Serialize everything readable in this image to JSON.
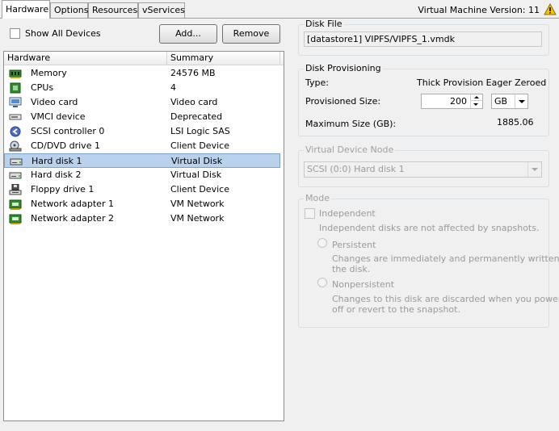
{
  "tabs": [
    {
      "label": "Hardware",
      "active": true
    },
    {
      "label": "Options",
      "active": false
    },
    {
      "label": "Resources",
      "active": false
    },
    {
      "label": "vServices",
      "active": false
    }
  ],
  "vm_version": "Virtual Machine Version: 11",
  "show_all_devices_label": "Show All Devices",
  "add_button": "Add...",
  "remove_button": "Remove",
  "columns": {
    "hardware": "Hardware",
    "summary": "Summary"
  },
  "devices": [
    {
      "name": "Memory",
      "summary": "24576 MB",
      "icon": "memory-icon"
    },
    {
      "name": "CPUs",
      "summary": "4",
      "icon": "cpu-icon"
    },
    {
      "name": "Video card",
      "summary": "Video card",
      "icon": "video-card-icon"
    },
    {
      "name": "VMCI device",
      "summary": "Deprecated",
      "icon": "vmci-device-icon"
    },
    {
      "name": "SCSI controller 0",
      "summary": "LSI Logic SAS",
      "icon": "scsi-controller-icon"
    },
    {
      "name": "CD/DVD drive 1",
      "summary": "Client Device",
      "icon": "cd-dvd-drive-icon"
    },
    {
      "name": "Hard disk 1",
      "summary": "Virtual Disk",
      "icon": "hard-disk-icon",
      "selected": true
    },
    {
      "name": "Hard disk 2",
      "summary": "Virtual Disk",
      "icon": "hard-disk-icon"
    },
    {
      "name": "Floppy drive 1",
      "summary": "Client Device",
      "icon": "floppy-drive-icon"
    },
    {
      "name": "Network adapter 1",
      "summary": "VM Network",
      "icon": "network-adapter-icon"
    },
    {
      "name": "Network adapter 2",
      "summary": "VM Network",
      "icon": "network-adapter-icon"
    }
  ],
  "disk_file": {
    "legend": "Disk File",
    "value": "[datastore1] VIPFS/VIPFS_1.vmdk"
  },
  "disk_provisioning": {
    "legend": "Disk Provisioning",
    "type_label": "Type:",
    "type_value": "Thick Provision Eager Zeroed",
    "provisioned_size_label": "Provisioned Size:",
    "provisioned_size_value": "200",
    "unit": "GB",
    "max_size_label": "Maximum Size (GB):",
    "max_size_value": "1885.06"
  },
  "virtual_device_node": {
    "legend": "Virtual Device Node",
    "value": "SCSI (0:0) Hard disk 1"
  },
  "mode": {
    "legend": "Mode",
    "independent_label": "Independent",
    "independent_desc": "Independent disks are not affected by snapshots.",
    "persistent_label": "Persistent",
    "persistent_desc_1": "Changes are immediately and permanently written to",
    "persistent_desc_2": "the disk.",
    "nonpersistent_label": "Nonpersistent",
    "nonpersistent_desc_1": "Changes to this disk are discarded when you power",
    "nonpersistent_desc_2": "off or revert to the snapshot."
  },
  "colors": {
    "selection": "#b9d1ea",
    "selection_border": "#7da2ce",
    "window_bg": "#f0f0f0",
    "disabled_text": "#9a9a9a"
  }
}
